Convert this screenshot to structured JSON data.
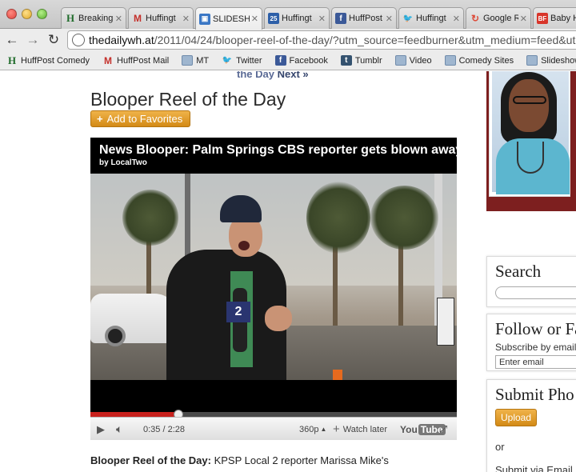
{
  "browser": {
    "tabs": [
      {
        "label": "Breaking",
        "icon": "H",
        "icon_color": "#1f6b2a"
      },
      {
        "label": "Huffingt",
        "icon": "M",
        "icon_color": "#c4302b"
      },
      {
        "label": "SLIDESHO",
        "icon": "▣",
        "icon_color": "#3a77c5"
      },
      {
        "label": "Huffingt",
        "icon": "25",
        "icon_color": "#2d5fa8"
      },
      {
        "label": "HuffPost",
        "icon": "f",
        "icon_color": "#3b5998"
      },
      {
        "label": "Huffingt",
        "icon": "🐦",
        "icon_color": "#3ab4e6"
      },
      {
        "label": "Google R",
        "icon": "↻",
        "icon_color": "#dd4b39"
      },
      {
        "label": "Baby H",
        "icon": "BF",
        "icon_color": "#d8352a"
      }
    ],
    "url_host": "thedailywh.at",
    "url_path": "/2011/04/24/blooper-reel-of-the-day/?utm_source=feedburner&utm_medium=feed&utm_",
    "bookmarks": [
      {
        "label": "HuffPost Comedy",
        "icon": "H"
      },
      {
        "label": "HuffPost Mail",
        "icon": "M"
      },
      {
        "label": "MT",
        "icon": "folder"
      },
      {
        "label": "Twitter",
        "icon": "🐦"
      },
      {
        "label": "Facebook",
        "icon": "f"
      },
      {
        "label": "Tumblr",
        "icon": "t"
      },
      {
        "label": "Video",
        "icon": "folder"
      },
      {
        "label": "Comedy Sites",
        "icon": "folder"
      },
      {
        "label": "Slideshow",
        "icon": "folder"
      }
    ]
  },
  "page": {
    "prev_text": "the Day",
    "next_text": "Next »",
    "title": "Blooper Reel of the Day",
    "add_favorites": "Add to Favorites",
    "video": {
      "title": "News Blooper:  Palm Springs CBS reporter gets blown away!",
      "byline": "by LocalTwo",
      "progress_fraction": 0.24,
      "time": "0:35 / 2:28",
      "quality": "360p",
      "watch_later": "Watch later",
      "youtube_a": "You",
      "youtube_b": "Tube",
      "mic_flag": "2"
    },
    "caption_bold": "Blooper Reel of the Day:",
    "caption_text": " KPSP Local 2 reporter Marissa Mike's"
  },
  "sidebar": {
    "search_title": "Search",
    "follow_title": "Follow or Fa",
    "follow_sub": "Subscribe by email",
    "email_placeholder": "Enter email",
    "submit_title": "Submit Pho",
    "upload_label": "Upload",
    "or_text": "or",
    "cut_text": "Submit via Email"
  }
}
